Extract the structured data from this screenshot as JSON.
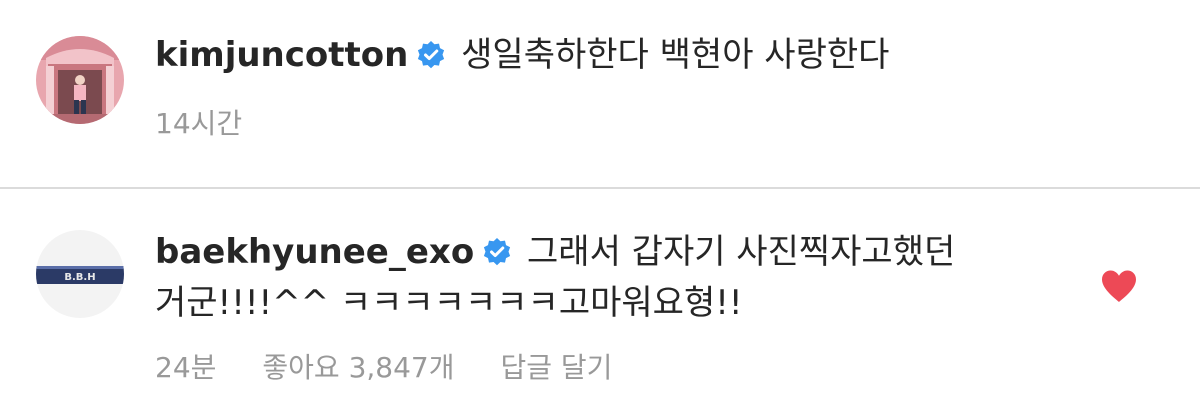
{
  "comments": [
    {
      "username": "kimjuncotton",
      "verified": true,
      "text": "생일축하한다 백현아 사랑한다",
      "time": "14시간",
      "avatar_icon": "profile-photo-person-pink-storefront"
    },
    {
      "username": "baekhyunee_exo",
      "verified": true,
      "text_line1": "그래서 갑자기 사진찍자고했던",
      "text_line2": "거군!!!!^^ ㅋㅋㅋㅋㅋㅋㅋ고마워요형!!",
      "time": "24분",
      "likes": "좋아요 3,847개",
      "reply": "답글 달기",
      "liked": true,
      "avatar_icon": "profile-photo-bbh-logo",
      "avatar_text": "B.B.H"
    }
  ],
  "colors": {
    "verified_badge": "#3897f0",
    "heart": "#ed4956",
    "meta_text": "#999999",
    "divider": "#dbdbdb"
  }
}
